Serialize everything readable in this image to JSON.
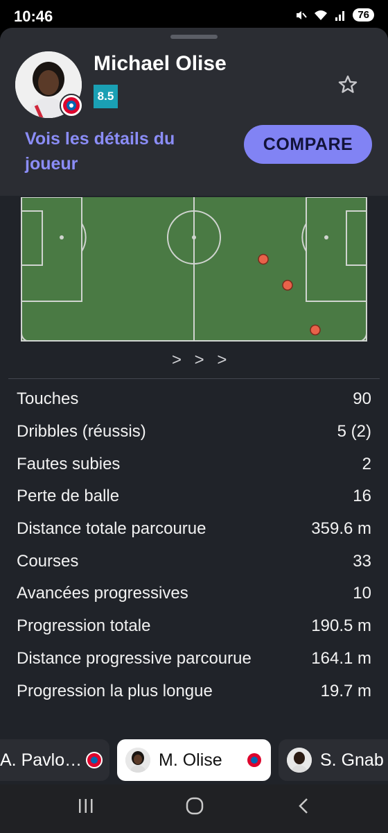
{
  "status_bar": {
    "time": "10:46",
    "battery": "76",
    "icons": [
      "mute-icon",
      "wifi-icon",
      "signal-icon"
    ]
  },
  "player": {
    "name": "Michael Olise",
    "rating": "8.5",
    "details_link": "Vois les détails du joueur",
    "compare_label": "COMPARE"
  },
  "heatmap": {
    "chevrons": "> > >",
    "points": [
      {
        "x": 0.7,
        "y": 0.43
      },
      {
        "x": 0.77,
        "y": 0.61
      },
      {
        "x": 0.85,
        "y": 0.92
      }
    ]
  },
  "stats": [
    {
      "label": "Touches",
      "value": "90"
    },
    {
      "label": "Dribbles (réussis)",
      "value": "5 (2)"
    },
    {
      "label": "Fautes subies",
      "value": "2"
    },
    {
      "label": "Perte de balle",
      "value": "16"
    },
    {
      "label": "Distance totale parcourue",
      "value": "359.6 m"
    },
    {
      "label": "Courses",
      "value": "33"
    },
    {
      "label": "Avancées progressives",
      "value": "10"
    },
    {
      "label": "Progression totale",
      "value": "190.5 m"
    },
    {
      "label": "Distance progressive parcourue",
      "value": "164.1 m"
    },
    {
      "label": "Progression la plus longue",
      "value": "19.7 m"
    }
  ],
  "player_tabs": [
    {
      "name": "A. Pavlo…"
    },
    {
      "name": "M. Olise"
    },
    {
      "name": "S. Gnab"
    }
  ],
  "colors": {
    "accent": "#8183f4",
    "rating": "#1aa0b4",
    "pitch": "#4a7a44",
    "dot": "#e8624a"
  }
}
